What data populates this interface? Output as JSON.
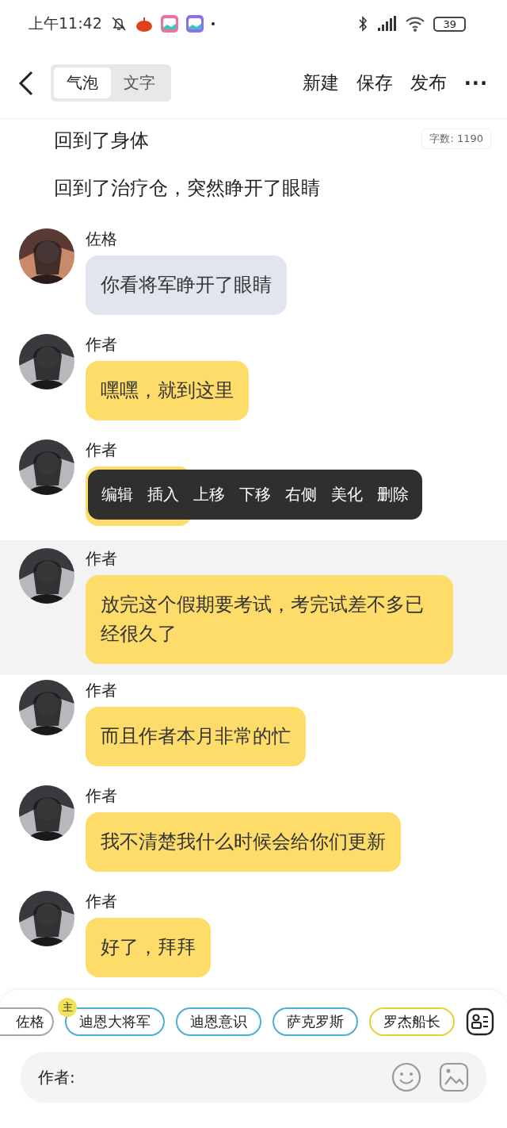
{
  "status_bar": {
    "time": "上午11:42",
    "battery": "39"
  },
  "top_bar": {
    "mode_tabs": [
      {
        "label": "气泡",
        "selected": true
      },
      {
        "label": "文字",
        "selected": false
      }
    ],
    "actions": [
      "新建",
      "保存",
      "发布"
    ],
    "more": "···"
  },
  "word_count": "字数: 1190",
  "narration": [
    "回到了身体",
    "回到了治疗仓，突然睁开了眼睛"
  ],
  "messages": [
    {
      "speaker": "佐格",
      "text": "你看将军睁开了眼睛",
      "color": "#e1e6ee",
      "selected": false
    },
    {
      "speaker": "作者",
      "text": "嘿嘿，就到这里",
      "color": "#fddc6a",
      "selected": false
    },
    {
      "speaker": "作者",
      "color": "#fddc6a",
      "selected": false,
      "menu": [
        "编辑",
        "插入",
        "上移",
        "下移",
        "右侧",
        "美化",
        "删除"
      ]
    },
    {
      "speaker": "作者",
      "text": "放完这个假期要考试，考完试差不多已经很久了",
      "color": "#fddc6a",
      "selected": true
    },
    {
      "speaker": "作者",
      "text": "而且作者本月非常的忙",
      "color": "#fddc6a",
      "selected": false
    },
    {
      "speaker": "作者",
      "text": "我不清楚我什么时候会给你们更新",
      "color": "#fddc6a",
      "selected": false
    },
    {
      "speaker": "作者",
      "text": "好了，拜拜",
      "color": "#fddc6a",
      "selected": false
    }
  ],
  "characters": [
    {
      "name": "佐格",
      "color": "#a0a6ad",
      "kind": "cut"
    },
    {
      "name": "迪恩大将军",
      "color": "#4aaed6",
      "kind": "main",
      "badge": "主"
    },
    {
      "name": "迪恩意识",
      "color": "#4aaed6",
      "kind": "plain"
    },
    {
      "name": "萨克罗斯",
      "color": "#4aaed6",
      "kind": "plain"
    },
    {
      "name": "罗杰船长",
      "color": "#e8cf3a",
      "kind": "plain"
    }
  ],
  "input": {
    "placeholder": "作者:"
  }
}
